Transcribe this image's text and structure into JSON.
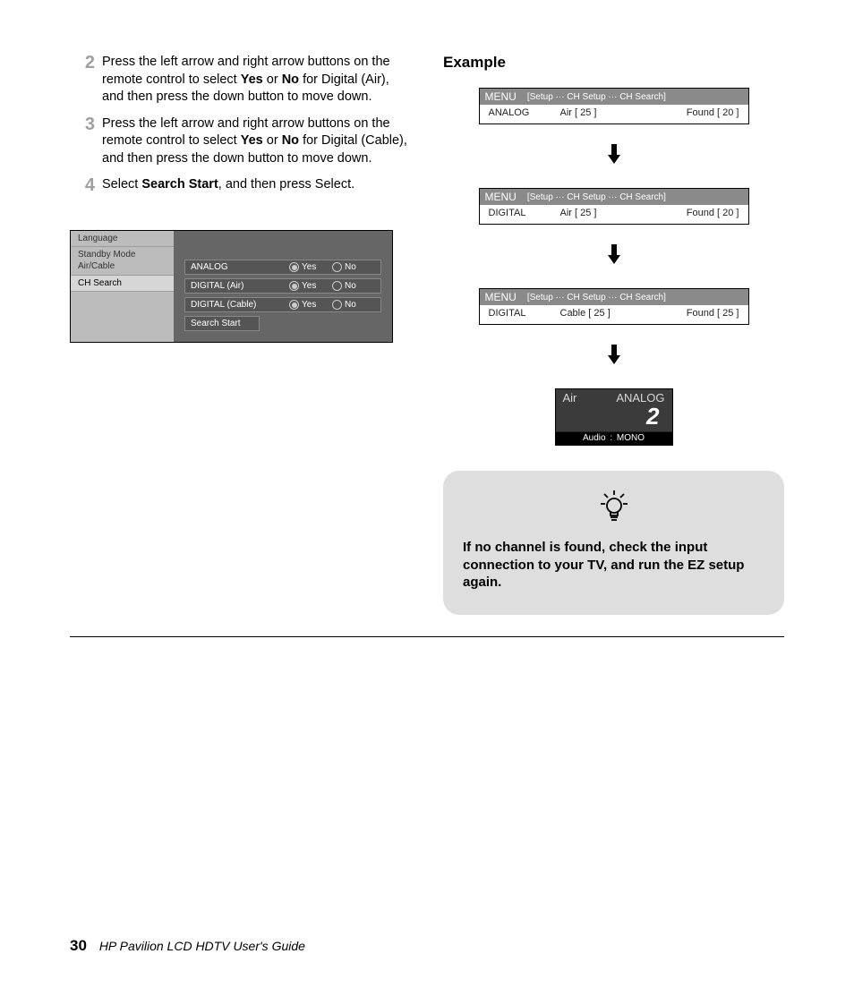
{
  "steps": {
    "s2": {
      "num": "2",
      "pre": "Press the left arrow and right arrow buttons on the remote control to select ",
      "b1": "Yes",
      "mid": " or ",
      "b2": "No",
      "post": " for Digital (Air), and then press the down button to move down."
    },
    "s3": {
      "num": "3",
      "pre": "Press the left arrow and right arrow buttons on the remote control to select ",
      "b1": "Yes",
      "mid": " or ",
      "b2": "No",
      "post": " for Digital (Cable), and then press the down button to move down."
    },
    "s4": {
      "num": "4",
      "pre": "Select ",
      "b1": "Search Start",
      "post": ", and then press Select."
    }
  },
  "menu": {
    "side": {
      "language": "Language",
      "standby": "Standby Mode",
      "aircable": "Air/Cable",
      "chsearch": "CH Search"
    },
    "rows": {
      "r1": {
        "label": "ANALOG",
        "yes": "Yes",
        "no": "No"
      },
      "r2": {
        "label": "DIGITAL (Air)",
        "yes": "Yes",
        "no": "No"
      },
      "r3": {
        "label": "DIGITAL (Cable)",
        "yes": "Yes",
        "no": "No"
      }
    },
    "start": "Search Start"
  },
  "example": {
    "heading": "Example"
  },
  "prog": {
    "menu": "MENU",
    "crumb": "[Setup ··· CH Setup ··· CH Search]",
    "box1": {
      "type": "ANALOG",
      "src": "Air [  25 ]",
      "found": "Found [  20 ]"
    },
    "box2": {
      "type": "DIGITAL",
      "src": "Air [  25 ]",
      "found": "Found [  20 ]"
    },
    "box3": {
      "type": "DIGITAL",
      "src": "Cable [  25 ]",
      "found": "Found [  25 ]"
    }
  },
  "chan": {
    "air": "Air",
    "mode": "ANALOG",
    "num": "2",
    "audio": "Audio   :   MONO"
  },
  "tip": {
    "text": "If no channel is found, check the input connection to your TV, and run the EZ setup again."
  },
  "footer": {
    "page": "30",
    "title": "HP Pavilion LCD HDTV User's Guide"
  }
}
